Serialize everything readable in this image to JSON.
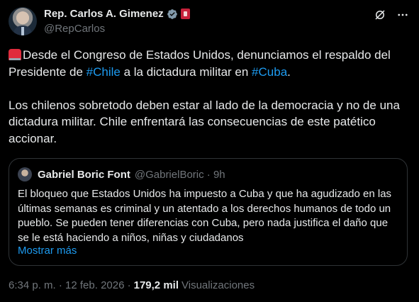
{
  "author": {
    "display_name": "Rep. Carlos A. Gimenez",
    "handle": "@RepCarlos"
  },
  "tweet": {
    "line1_prefix": "Desde el Congreso de Estados Unidos, denunciamos el respaldo del",
    "line2_prefix": "Presidente de ",
    "hashtag_chile": "#Chile",
    "line2_middle": " a la dictadura militar en ",
    "hashtag_cuba": "#Cuba",
    "line2_suffix": ".",
    "paragraph2": "Los chilenos sobretodo deben estar al lado de la democracia y no de una dictadura  militar. Chile enfrentará las consecuencias de este patético accionar."
  },
  "quoted": {
    "display_name": "Gabriel Boric Font",
    "meta": "@GabrielBoric · 9h",
    "text": "El bloqueo que Estados Unidos ha impuesto a Cuba y que ha agudizado en las últimas semanas es criminal y un atentado a los derechos humanos de todo un pueblo. Se pueden tener diferencias con Cuba, pero nada justifica el daño que se le está haciendo a niños, niñas y ciudadanos",
    "show_more": "Mostrar más"
  },
  "footer": {
    "timestamp": "6:34 p. m. · 12 feb. 2026 ·",
    "views_count": "179,2 mil",
    "views_label": "Visualizaciones"
  },
  "colors": {
    "background": "#000000",
    "text": "#e7e9ea",
    "muted": "#71767b",
    "link": "#1d9bf0",
    "border": "#2f3336"
  },
  "icons": [
    "verified-badge-icon",
    "government-flag-icon",
    "grok-icon",
    "more-options-icon",
    "siren-emoji-icon"
  ]
}
